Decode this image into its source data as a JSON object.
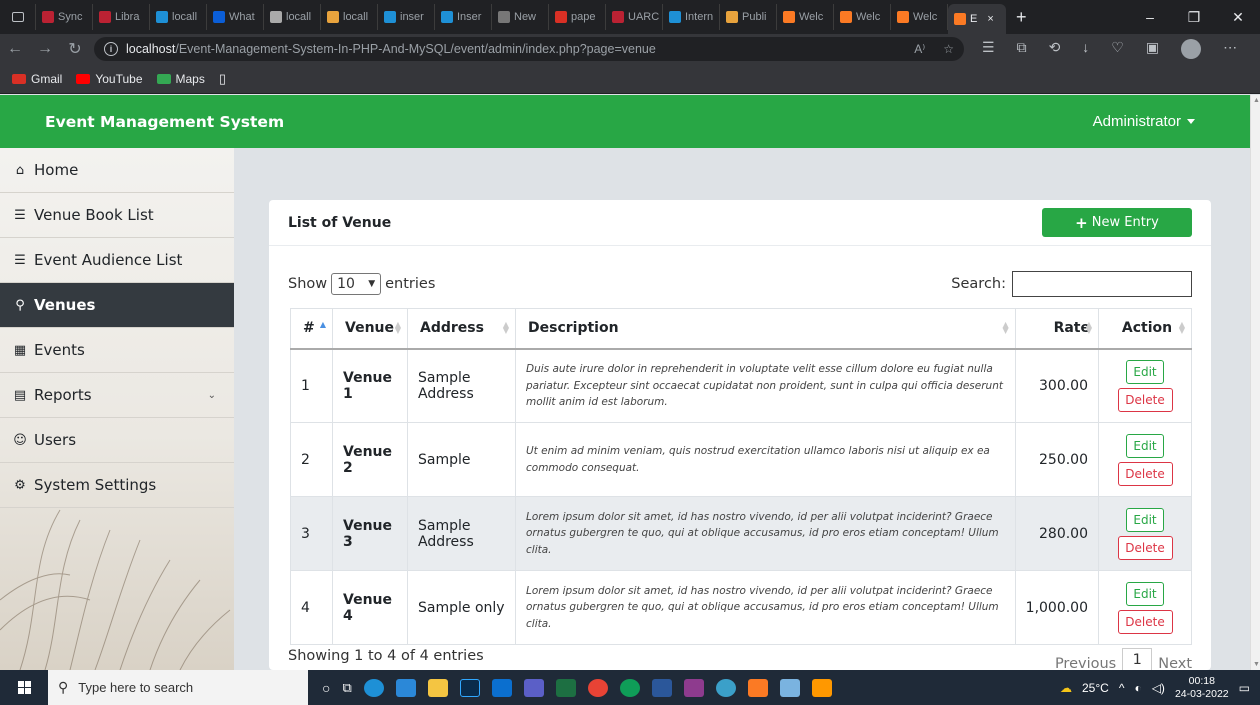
{
  "browser": {
    "tabs": [
      "Sync",
      "Libra",
      "locall",
      "What",
      "locall",
      "locall",
      "inser",
      "Inser",
      "New",
      "pape",
      "UARC",
      "Intern",
      "Publi",
      "Welc",
      "Welc",
      "Welc",
      "E"
    ],
    "active_tab_close": "×",
    "new_tab": "+",
    "url_host": "localhost",
    "url_path": "/Event-Management-System-In-PHP-And-MySQL/event/admin/index.php?page=venue",
    "bookmarks": [
      {
        "label": "Gmail",
        "color": "#d93025"
      },
      {
        "label": "YouTube",
        "color": "#ff0000"
      },
      {
        "label": "Maps",
        "color": "#34a853"
      }
    ]
  },
  "app": {
    "brand": "Event Management System",
    "user": "Administrator",
    "accent": "#28a745"
  },
  "sidebar": {
    "items": [
      {
        "label": "Home",
        "icon": "home-icon",
        "glyph": "⌂"
      },
      {
        "label": "Venue Book List",
        "icon": "list-icon",
        "glyph": "☰"
      },
      {
        "label": "Event Audience List",
        "icon": "list-icon",
        "glyph": "☰"
      },
      {
        "label": "Venues",
        "icon": "map-marker-icon",
        "glyph": "⚲"
      },
      {
        "label": "Events",
        "icon": "calendar-icon",
        "glyph": "▦"
      },
      {
        "label": "Reports",
        "icon": "file-icon",
        "glyph": "▤"
      },
      {
        "label": "Users",
        "icon": "users-icon",
        "glyph": "☺"
      },
      {
        "label": "System Settings",
        "icon": "cogs-icon",
        "glyph": "⚙"
      }
    ]
  },
  "card": {
    "title": "List of Venue",
    "new_button": "New Entry",
    "show_label": "Show",
    "entries_value": "10",
    "entries_label": "entries",
    "search_label": "Search:",
    "search_value": ""
  },
  "table": {
    "headers": [
      "#",
      "Venue",
      "Address",
      "Description",
      "Rate",
      "Action"
    ],
    "rows": [
      {
        "num": "1",
        "venue": "Venue 1",
        "address": "Sample Address",
        "description": "Duis aute irure dolor in reprehenderit in voluptate velit esse cillum dolore eu fugiat nulla pariatur. Excepteur sint occaecat cupidatat non proident, sunt in culpa qui officia deserunt mollit anim id est laborum.",
        "rate": "300.00"
      },
      {
        "num": "2",
        "venue": "Venue 2",
        "address": "Sample",
        "description": "Ut enim ad minim veniam, quis nostrud exercitation ullamco laboris nisi ut aliquip ex ea commodo consequat.",
        "rate": "250.00"
      },
      {
        "num": "3",
        "venue": "Venue 3",
        "address": "Sample Address",
        "description": "Lorem ipsum dolor sit amet, id has nostro vivendo, id per alii volutpat inciderint? Graece ornatus gubergren te quo, qui at oblique accusamus, id pro eros etiam conceptam! Ullum clita.",
        "rate": "280.00"
      },
      {
        "num": "4",
        "venue": "Venue 4",
        "address": "Sample only",
        "description": "Lorem ipsum dolor sit amet, id has nostro vivendo, id per alii volutpat inciderint? Graece ornatus gubergren te quo, qui at oblique accusamus, id pro eros etiam conceptam! Ullum clita.",
        "rate": "1,000.00"
      }
    ],
    "edit_label": "Edit",
    "delete_label": "Delete"
  },
  "footer": {
    "info": "Showing 1 to 4 of 4 entries",
    "previous": "Previous",
    "page": "1",
    "next": "Next"
  },
  "taskbar": {
    "search_placeholder": "Type here to search",
    "weather": "25°C",
    "time": "00:18",
    "date": "24-03-2022"
  }
}
